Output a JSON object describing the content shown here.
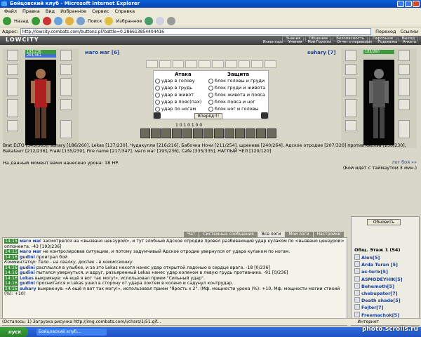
{
  "window": {
    "title": "Бойцовский клуб - Microsoft Internet Explorer"
  },
  "menu": [
    "Файл",
    "Правка",
    "Вид",
    "Избранное",
    "Сервис",
    "Справка"
  ],
  "toolbar": {
    "back": "Назад",
    "search": "Поиск",
    "favorites": "Избранное"
  },
  "address": {
    "label": "Адрес:",
    "url": "http://lowcity.combats.com/buttons.pl?battle=0.286613854404416",
    "go": "Переход",
    "links": "Ссылки"
  },
  "site": {
    "logo": "LOWCITY",
    "nav": [
      "Знания",
      "Общение",
      "Безопасность",
      "Персонаж",
      "Выход"
    ],
    "nav2": [
      "Инвентарь",
      "Умения",
      "Мой Гороспл",
      "Отчет о переводах",
      "Подсказка",
      "Анкета"
    ]
  },
  "fighter_left": {
    "name": "маго маг [6]",
    "hp": "193/236",
    "mp": "263/361"
  },
  "fighter_right": {
    "name": "suhary [7]",
    "hp": "186/260"
  },
  "combat": {
    "attack_title": "Атака",
    "defense_title": "Защита",
    "attacks": [
      "удар в голову",
      "удар в грудь",
      "удар в живот",
      "удар в пояс(пах)",
      "удар по ногам"
    ],
    "blocks": [
      "блок головы и груди",
      "блок груди и живота",
      "блок живота и пояса",
      "блок пояса и ног",
      "блок ног и головы"
    ],
    "go_button": "Вперёд!!!"
  },
  "stats_line": "1  0  1  0  1  0  0",
  "fighters_text": {
    "left": "Brat ELTO [345/363], suhary [186/260], Lekas [137/230], Чудакулли [216/216], Бабочка Ночи [211/254], шрекевв [240/264], Адское отродие [207/320] против каблэа [230/230], Bakalavrr [212/236], FraAl [135/230], Fire name [217/347], маго маг [193/236], Cafe [335/335], НАГЛЫЙ ЧЕЛ [120/120]"
  },
  "damage": "На данный момент вами нанесено урона: 18 HP.",
  "timeout": "лог боя »»",
  "timeout2": "(Бой идет с таймаутом 3 мин.)",
  "tabs": [
    "Чат",
    "Системные сообщения",
    "Все логи",
    "Мои логи",
    "Настройки"
  ],
  "chat": [
    {
      "time": "14:15",
      "name": "маго маг",
      "text": "засмотрелся на <вызвано цензурой>, и тут злобный Адское отродие провел разбивающий удар кулаком по <вызвано цензурой> оппонента. -43 [193/236]"
    },
    {
      "time": "14:15",
      "name": "маго маг",
      "text": "не контролировав ситуацию, и потому задумчивый Адское отродие увернулся от удара кулаком по ногам."
    },
    {
      "time": "14:16",
      "name": "gudini",
      "text": "проиграл бой"
    },
    {
      "time": "",
      "name": "",
      "text": "Комментатор: Тело - на свалку, доспек - в комиссионку."
    },
    {
      "time": "14:16",
      "name": "gudini",
      "text": "расплылся в улыбке, и за это Lekas нехотя нанес удар открытой ладонью в сердце врага. -18 [0/236]"
    },
    {
      "time": "14:16",
      "name": "gudini",
      "text": "пытался увернуться, и вдруг, разъяренный Lekas нанес удар коленом в левую грудь противника. -91 [0/236]"
    },
    {
      "time": "14:16",
      "name": "Lekas",
      "text": "выкрикнув: «А ещё я вот так могу!», использовал прием \"Сильный удар\"."
    },
    {
      "time": "14:16",
      "name": "gudini",
      "text": "проснитался и Lekas ушел в сторону от удара локтем в колено и садунул контрудар."
    },
    {
      "time": "14:16",
      "name": "suhary",
      "text": "выкрикнув: «А ещё я вот так могу!», использовал прием \"Ярость х 2\". (Мф. мощности урона (%): +10, Мф. мощности магии стихий (%): +10)"
    }
  ],
  "side": {
    "refresh": "Обновить",
    "title": "Общ. Этаж 1 (54)",
    "users": [
      "Alen[5]",
      "Arda Turan [5]",
      "as-terix[5]",
      "ASMODEYHIK[5]",
      "Behemoth[5]",
      "chebupator[7]",
      "Death shade[5]",
      "Fojter[7]",
      "Freemachok[5]"
    ]
  },
  "statusbar": {
    "text": "(Осталось: 1) Загрузка рисунка http://img.combats.com/i/chars/1/51.gif...",
    "zone": "Интернет"
  },
  "taskbar": {
    "start": "пуск",
    "task": "Бойцовский клуб..."
  },
  "watermark": "photo.scrolls.ru"
}
